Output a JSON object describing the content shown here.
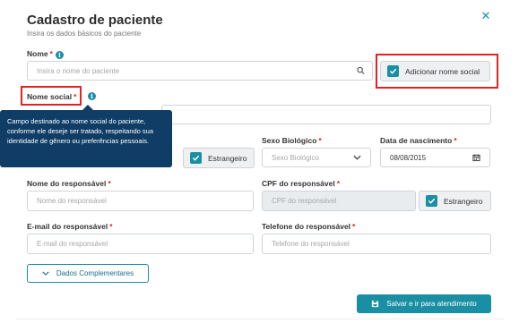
{
  "modal": {
    "title": "Cadastro de paciente",
    "subtitle": "Insira os dados básicos do paciente",
    "close_icon": "close-x-icon"
  },
  "fields": {
    "nome": {
      "label": "Nome",
      "required": "*",
      "placeholder": "Insira o nome do paciente"
    },
    "add_social": {
      "label": "Adicionar nome social",
      "checked": true
    },
    "nome_social": {
      "label": "Nome social",
      "required": "*"
    },
    "tooltip": {
      "text": "Campo destinado ao nome social do paciente, conforme ele deseje ser tratado, respeitando sua identidade de gênero ou preferências pessoais."
    },
    "estrangeiro_1": {
      "label": "Estrangeiro",
      "checked": true
    },
    "sexo": {
      "label": "Sexo Biológico",
      "required": "*",
      "placeholder": "Sexo Biológico"
    },
    "nascimento": {
      "label": "Data de nascimento",
      "required": "*",
      "value": "08/08/2015"
    },
    "nome_resp": {
      "label": "Nome do responsável",
      "required": "*",
      "placeholder": "Nome do responsável"
    },
    "cpf_resp": {
      "label": "CPF do responsável",
      "required": "*",
      "placeholder": "CPF do responsável"
    },
    "estrangeiro_2": {
      "label": "Estrangeiro",
      "checked": true
    },
    "email_resp": {
      "label": "E-mail do responsável",
      "required": "*",
      "placeholder": "E-mail do responsável"
    },
    "tel_resp": {
      "label": "Telefone do responsável",
      "required": "*",
      "placeholder": "Telefone do responsável"
    }
  },
  "actions": {
    "dados_complementares": "Dados Complementares",
    "salvar": "Salvar e ir para atendimento"
  },
  "colors": {
    "accent": "#1a8fa3",
    "required": "#e02424",
    "tooltip_bg": "#0f3d66",
    "highlight": "#e02424"
  }
}
